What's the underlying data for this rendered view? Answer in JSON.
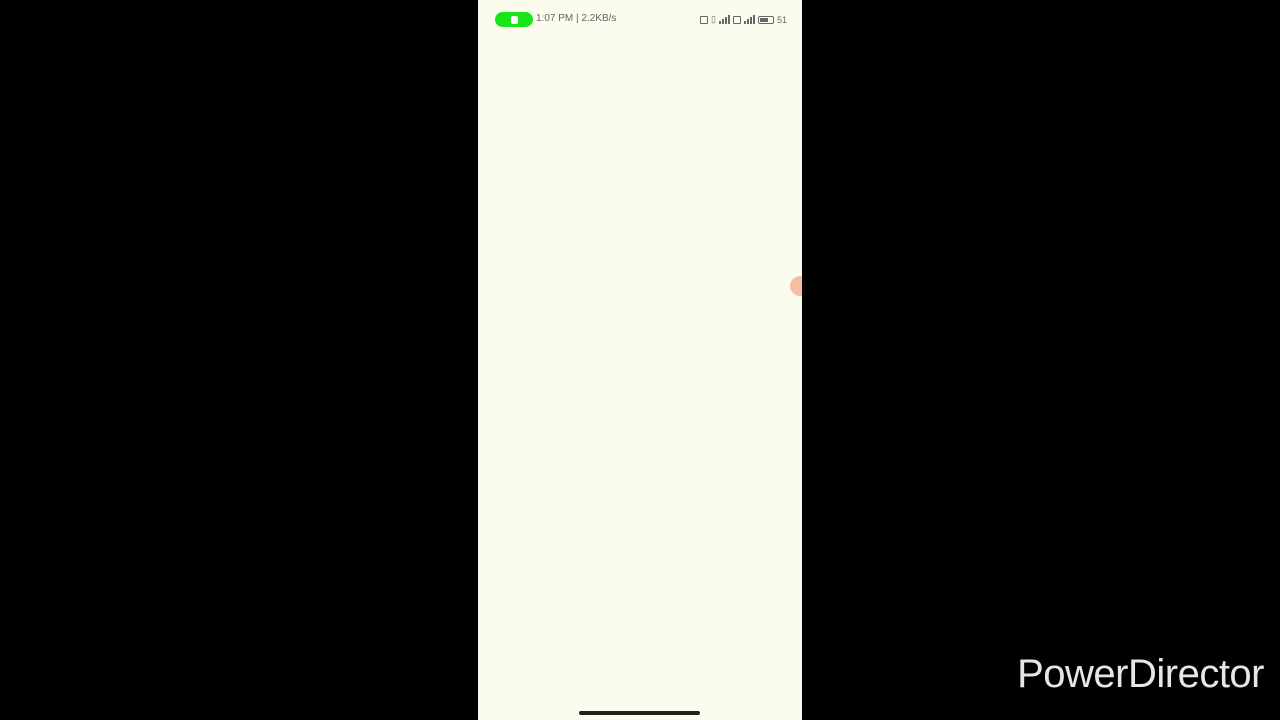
{
  "status_bar": {
    "time_and_speed": "1:07 PM | 2.2KB/s",
    "call_active": true,
    "battery_text": "51",
    "icons": [
      "phone-icon",
      "screenshot-icon",
      "volte-icon",
      "sim-icon",
      "signal-icon",
      "battery-icon"
    ]
  },
  "watermark": {
    "text": "PowerDirector"
  },
  "colors": {
    "screen_background": "#fcfcee",
    "call_pill": "#19e419",
    "letterbox": "#000000",
    "bubble": "#f6b494"
  }
}
